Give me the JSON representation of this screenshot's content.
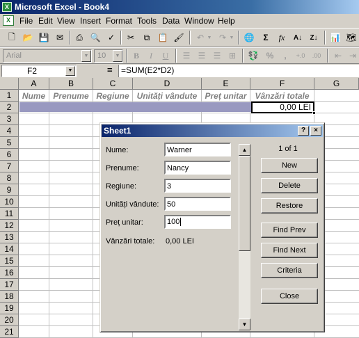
{
  "window": {
    "title": "Microsoft Excel - Book4"
  },
  "menu": {
    "items": [
      {
        "label": "File"
      },
      {
        "label": "Edit"
      },
      {
        "label": "View"
      },
      {
        "label": "Insert"
      },
      {
        "label": "Format"
      },
      {
        "label": "Tools"
      },
      {
        "label": "Data"
      },
      {
        "label": "Window"
      },
      {
        "label": "Help"
      }
    ]
  },
  "format_toolbar": {
    "font_name": "Arial",
    "font_size": "10"
  },
  "formula_bar": {
    "name_box": "F2",
    "equals": "=",
    "formula": "=SUM(E2*D2)"
  },
  "sheet": {
    "columns": [
      "A",
      "B",
      "C",
      "D",
      "E",
      "F",
      "G"
    ],
    "rows": [
      "1",
      "2",
      "3",
      "4",
      "5",
      "6",
      "7",
      "8",
      "9",
      "10",
      "11",
      "12",
      "13",
      "14",
      "15",
      "16",
      "17",
      "18",
      "19",
      "20",
      "21"
    ],
    "header_cells": [
      "Nume",
      "Prenume",
      "Regiune",
      "Unități vândute",
      "Preț unitar",
      "Vânzări totale"
    ],
    "f2_value": "0,00 LEI"
  },
  "dialog": {
    "title": "Sheet1",
    "help_btn": "?",
    "close_btn": "×",
    "fields": [
      {
        "label": "Nume:",
        "value": "Warner"
      },
      {
        "label": "Prenume:",
        "value": "Nancy"
      },
      {
        "label": "Regiune:",
        "value": "3"
      },
      {
        "label": "Unități vândute:",
        "value": "50"
      },
      {
        "label": "Preț unitar:",
        "value": "100"
      }
    ],
    "total_label": "Vânzări totale:",
    "total_value": "0,00 LEI",
    "record_position": "1 of 1",
    "buttons": {
      "new": "New",
      "delete": "Delete",
      "restore": "Restore",
      "find_prev": "Find Prev",
      "find_next": "Find Next",
      "criteria": "Criteria",
      "close": "Close"
    }
  },
  "colors": {
    "title_bar": "#0a246a",
    "selection_fill": "#9999c0",
    "face": "#d4d0c8"
  }
}
